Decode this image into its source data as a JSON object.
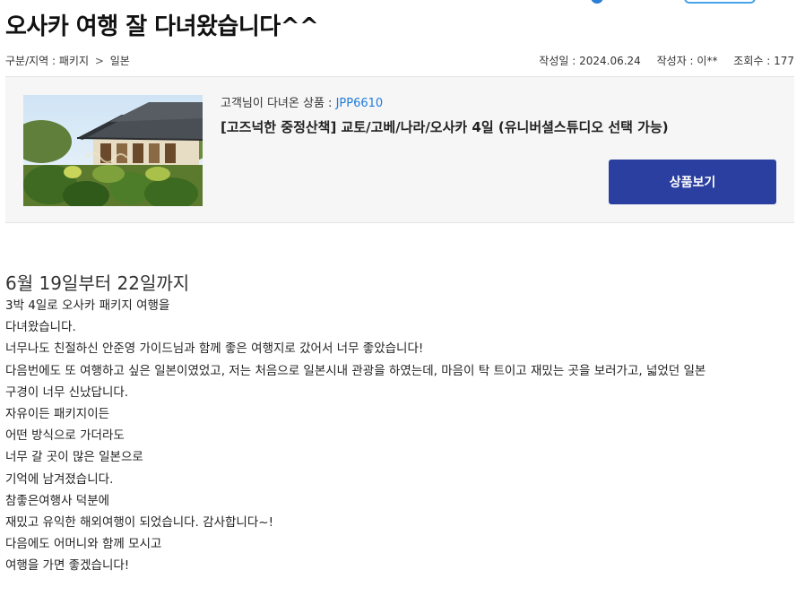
{
  "post": {
    "title": "오사카 여행 잘 다녀왔습니다^^",
    "category_label": "구분/지역 : 패키지",
    "category_sep": ">",
    "category_region": "일본",
    "date": "작성일 : 2024.06.24",
    "author": "작성자 : 이**",
    "views": "조회수 : 177"
  },
  "product": {
    "code_label": "고객님이 다녀온 상품 : ",
    "code": "JPP6610",
    "name": "[고즈넉한 중정산책] 교토/고베/나라/오사카 4일 (유니버셜스튜디오 선택 가능)",
    "button_label": "상품보기",
    "image_alt": "일본 전통 가옥과 정원 사진"
  },
  "content": {
    "heading": "6월 19일부터 22일까지",
    "lines": [
      "3박 4일로 오사카 패키지 여행을",
      "다녀왔습니다.",
      "너무나도 친절하신 안준영 가이드님과 함께 좋은 여행지로 갔어서 너무 좋았습니다!",
      "다음번에도 또 여행하고 싶은 일본이였었고, 저는 처음으로 일본시내 관광을 하였는데, 마음이 탁 트이고 재밌는 곳을 보러가고, 넓었던 일본",
      "구경이 너무 신났답니다.",
      "자유이든 패키지이든",
      "어떤 방식으로 가더라도",
      "너무 갈 곳이 많은 일본으로",
      "기억에 남겨졌습니다.",
      "참좋은여행사 덕분에",
      "재밌고 유익한 해외여행이 되었습니다. 감사합니다~!",
      "다음에도 어머니와 함께 모시고",
      "여행을 가면 좋겠습니다!"
    ]
  },
  "colors": {
    "accent_blue": "#1f7bd8",
    "button_bg": "#2a3fa0"
  }
}
